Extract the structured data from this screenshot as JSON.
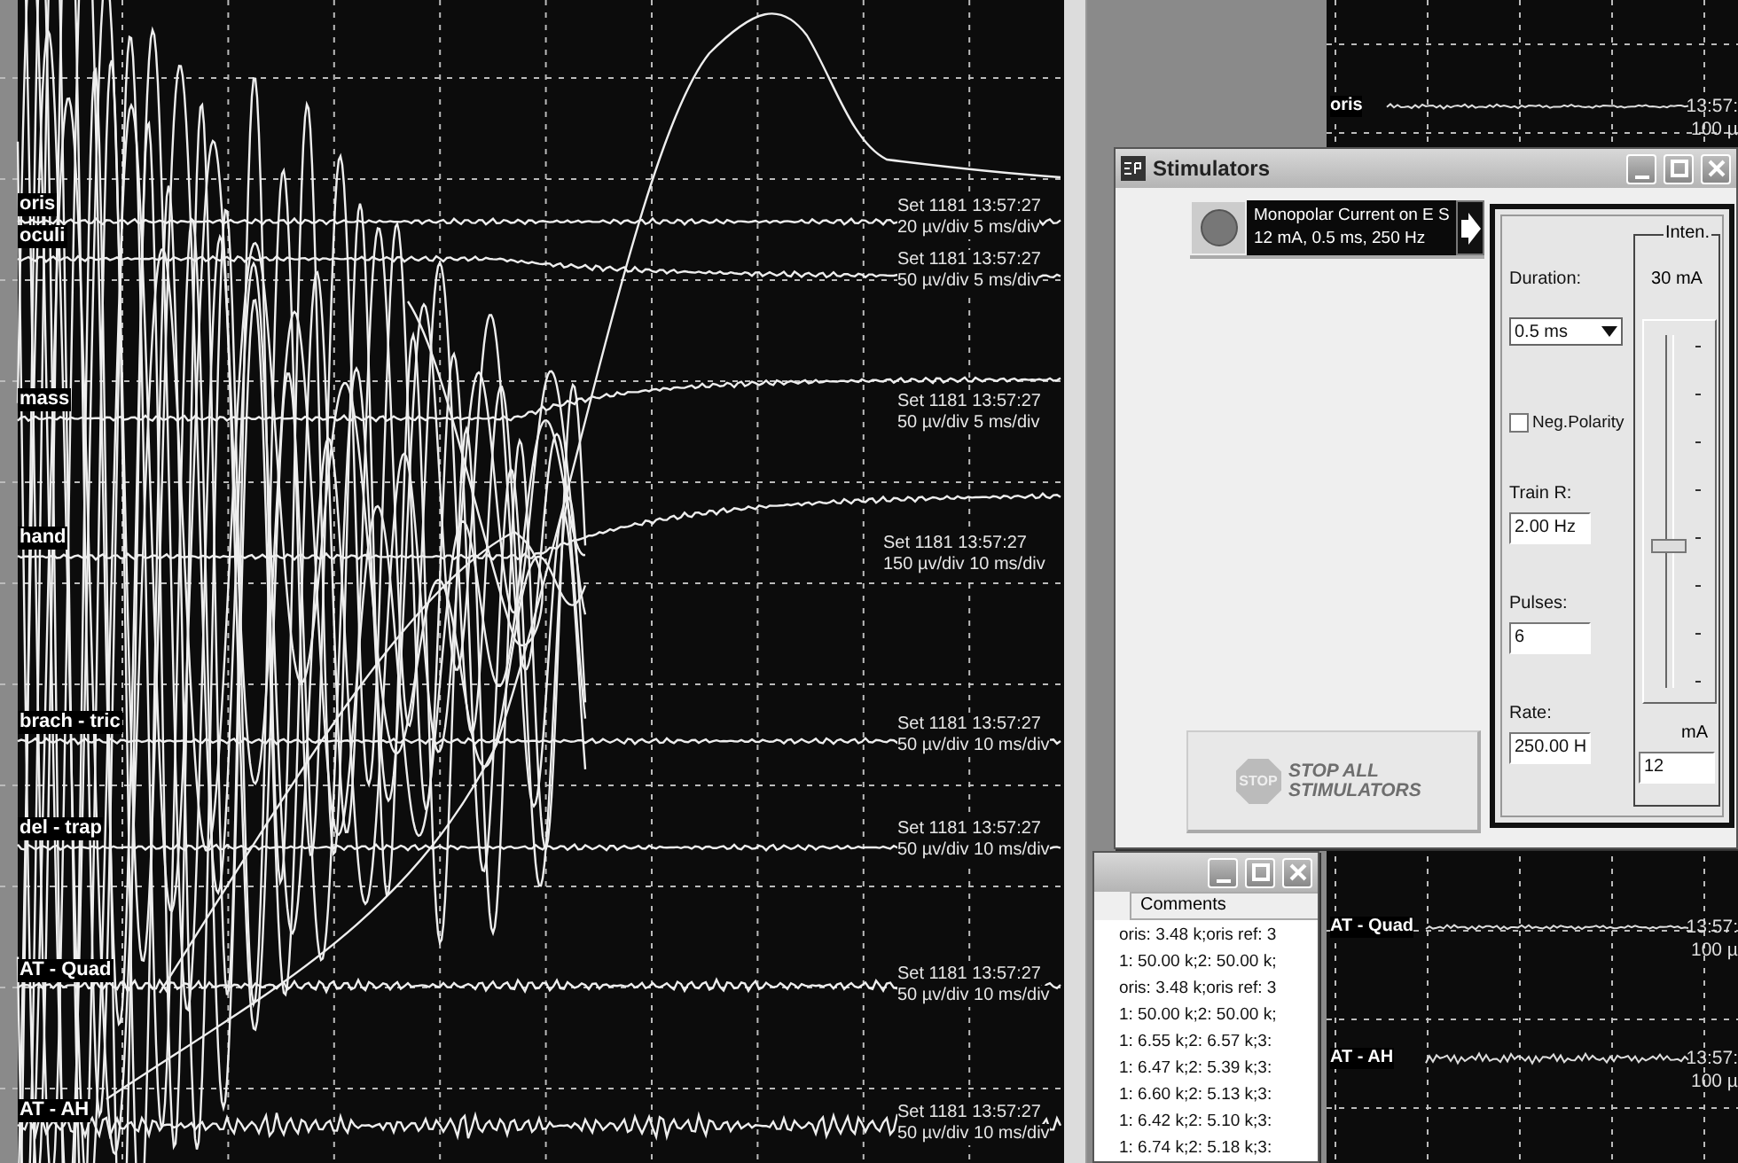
{
  "trace_view": {
    "channels": [
      {
        "label": "oris",
        "time": "Set 1181 13:57:27",
        "scale": "20 µv/div 5 ms/div"
      },
      {
        "label": "oculi",
        "time": "Set 1181 13:57:27",
        "scale": "50 µv/div 5 ms/div"
      },
      {
        "label": "mass",
        "time": "Set 1181 13:57:27",
        "scale": "50 µv/div 5 ms/div"
      },
      {
        "label": "hand",
        "time": "Set 1181 13:57:27",
        "scale": "150 µv/div 10 ms/div"
      },
      {
        "label": "brach - tric",
        "time": "Set 1181 13:57:27",
        "scale": "50 µv/div 10 ms/div"
      },
      {
        "label": "del - trap",
        "time": "Set 1181 13:57:27",
        "scale": "50 µv/div 10 ms/div"
      },
      {
        "label": "AT - Quad",
        "time": "Set 1181 13:57:27",
        "scale": "50 µv/div 10 ms/div"
      },
      {
        "label": "AT - AH",
        "time": "Set 1181 13:57:27",
        "scale": "50 µv/div 10 ms/div"
      }
    ]
  },
  "right_trace_view": {
    "channels": [
      {
        "label": "oris",
        "time": "13:57:",
        "scale": "100 µ"
      },
      {
        "label": "AT - Quad",
        "time": "13:57:",
        "scale": "100 µ"
      },
      {
        "label": "AT - AH",
        "time": "13:57:",
        "scale": "100 µ"
      }
    ]
  },
  "stimulators": {
    "title": "Stimulators",
    "stimulator": {
      "name": "Monopolar Current on E S",
      "settings": "12 mA, 0.5 ms, 250 Hz"
    },
    "stop_button": {
      "sign": "STOP",
      "label": "STOP ALL STIMULATORS",
      "disabled": true
    },
    "duration_label": "Duration:",
    "duration": "0.5 ms",
    "neg_polarity": {
      "label": "Neg.Polarity",
      "checked": false
    },
    "train_rate_label": "Train R:",
    "train_rate": "2.00 Hz",
    "pulses_label": "Pulses:",
    "pulses": "6",
    "rate_label": "Rate:",
    "rate": "250.00 H",
    "intensity": {
      "legend": "Inten.",
      "maximum": "30 mA",
      "level": 0.4,
      "unit": "mA",
      "value": "12"
    }
  },
  "comments_window": {
    "column": "Comments",
    "rows": [
      "oris: 3.48 k;oris ref: 3",
      "1: 50.00 k;2: 50.00 k;",
      "oris: 3.48 k;oris ref: 3",
      "1: 50.00 k;2: 50.00 k;",
      "1: 6.55 k;2: 6.57 k;3:",
      "1: 6.47 k;2: 5.39 k;3:",
      "1: 6.60 k;2: 5.13 k;3:",
      "1: 6.42 k;2: 5.10 k;3:",
      "1: 6.74 k;2: 5.18 k;3:"
    ]
  }
}
